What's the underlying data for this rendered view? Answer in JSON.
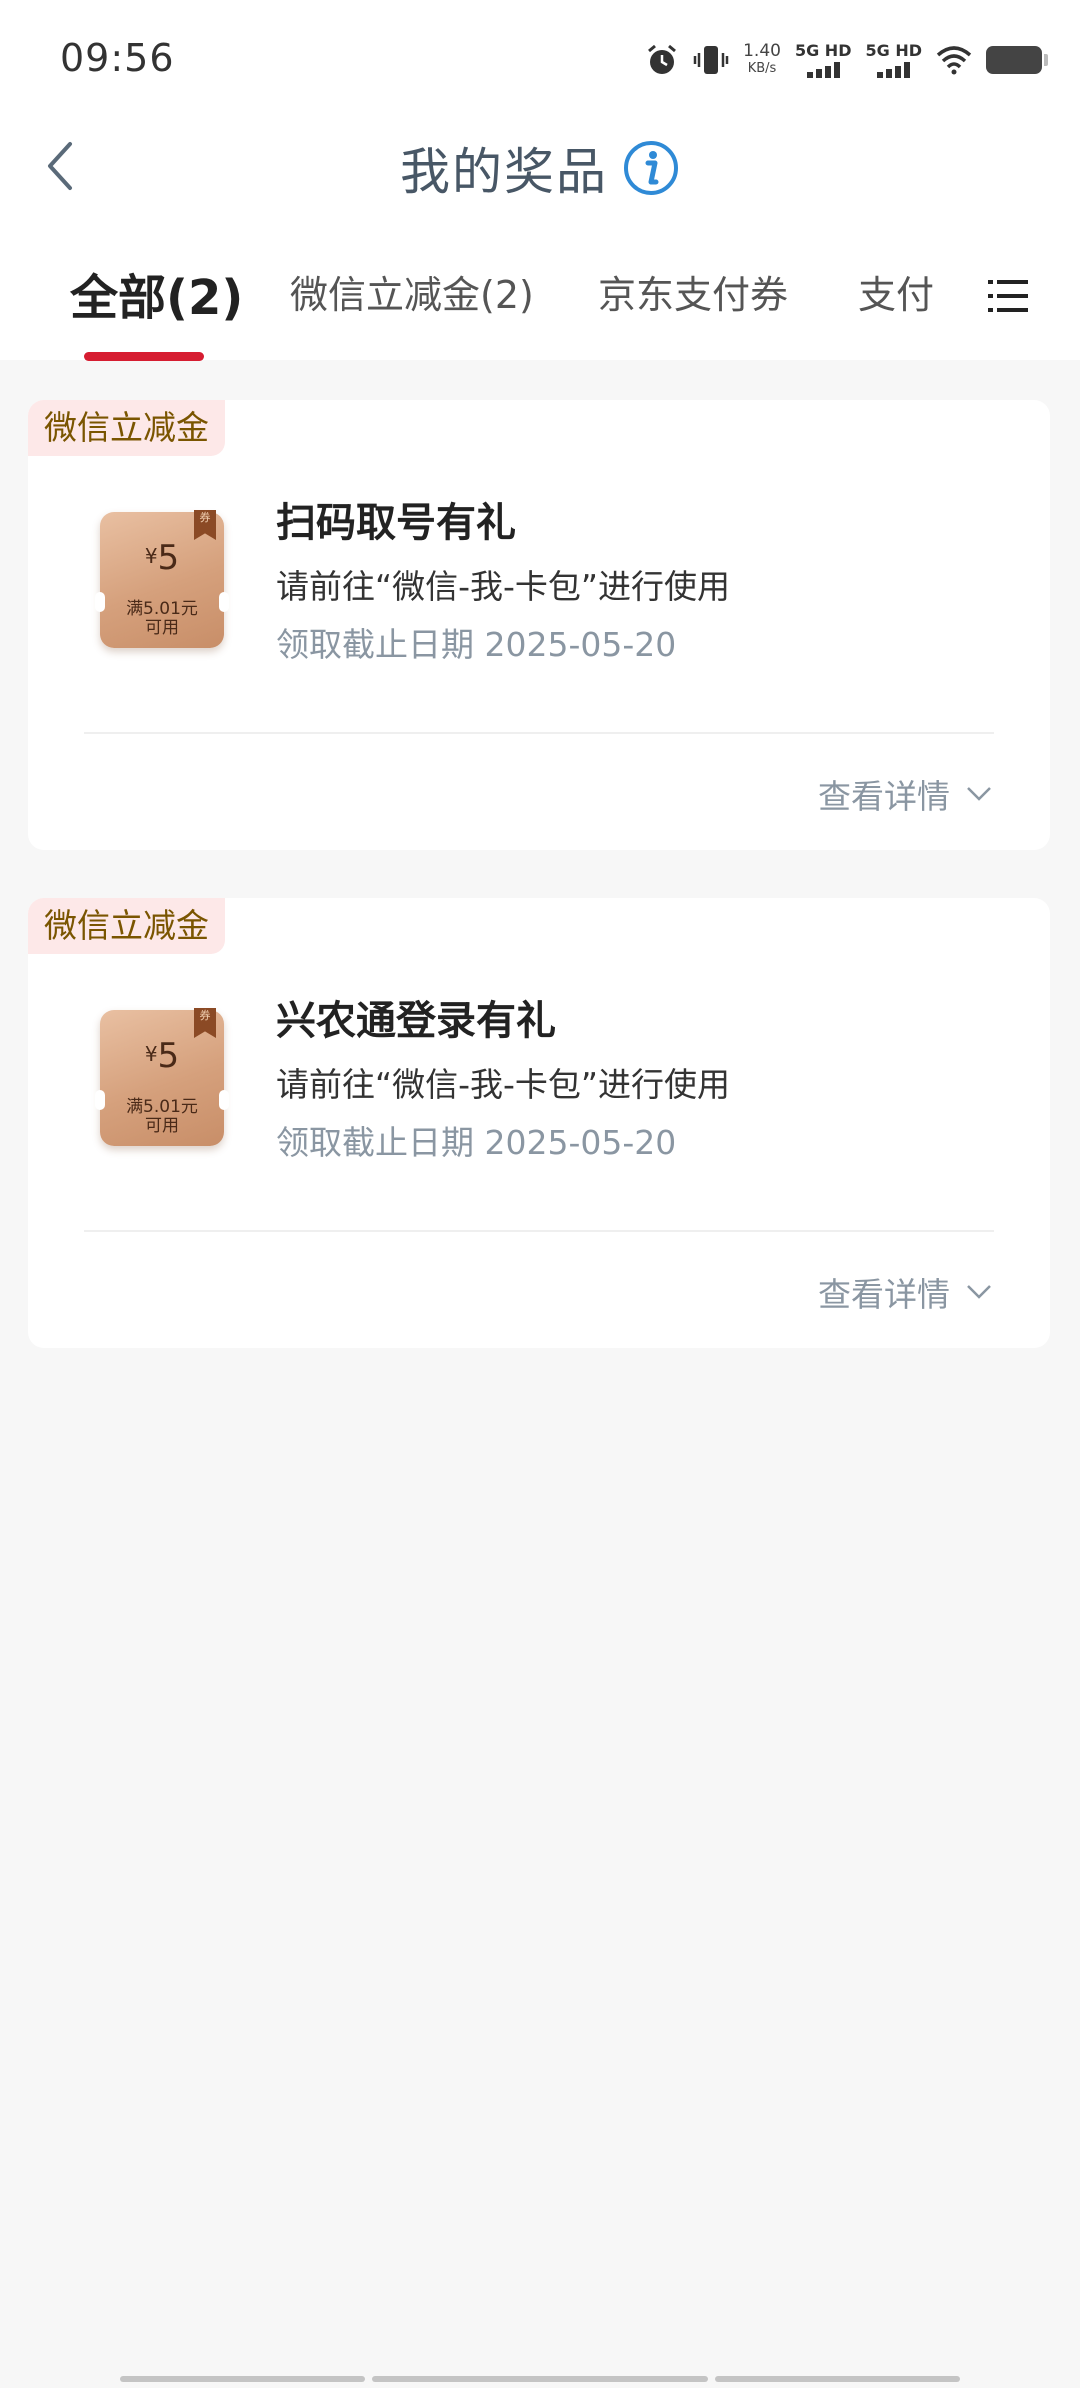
{
  "status": {
    "time": "09:56",
    "net_speed": "1.40",
    "net_unit": "KB/s",
    "sim1": "5G HD",
    "sim2": "5G HD",
    "icons": [
      "alarm-icon",
      "vibrate-icon",
      "wifi-icon",
      "battery-icon"
    ]
  },
  "header": {
    "title": "我的奖品",
    "back_icon": "chevron-left-icon",
    "info_icon": "info-icon"
  },
  "tabs": [
    {
      "label": "全部(2)",
      "active": true
    },
    {
      "label": "微信立减金(2)",
      "active": false
    },
    {
      "label": "京东支付券",
      "active": false
    },
    {
      "label": "支付",
      "active": false
    }
  ],
  "menu_icon": "list-menu-icon",
  "accent_color": "#d61d31",
  "prizes": [
    {
      "tag": "微信立减金",
      "coupon_yen": "¥",
      "coupon_amount": "5",
      "coupon_badge": "券",
      "coupon_cond_1": "满5.01元",
      "coupon_cond_2": "可用",
      "title": "扫码取号有礼",
      "subtitle": "请前往“微信-我-卡包”进行使用",
      "deadline": "领取截止日期 2025-05-20",
      "detail_label": "查看详情"
    },
    {
      "tag": "微信立减金",
      "coupon_yen": "¥",
      "coupon_amount": "5",
      "coupon_badge": "券",
      "coupon_cond_1": "满5.01元",
      "coupon_cond_2": "可用",
      "title": "兴农通登录有礼",
      "subtitle": "请前往“微信-我-卡包”进行使用",
      "deadline": "领取截止日期 2025-05-20",
      "detail_label": "查看详情"
    }
  ]
}
